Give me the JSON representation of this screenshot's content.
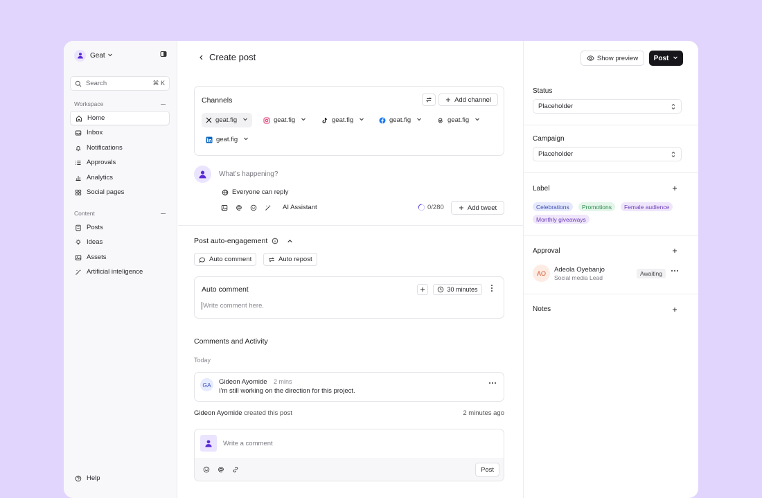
{
  "sidebar": {
    "workspace_name": "Geat",
    "search_placeholder": "Search",
    "search_shortcut": "⌘ K",
    "workspace_section": "Workspace",
    "workspace_items": [
      {
        "label": "Home",
        "icon": "home-icon"
      },
      {
        "label": "Inbox",
        "icon": "inbox-icon"
      },
      {
        "label": "Notifications",
        "icon": "bell-icon"
      },
      {
        "label": "Approvals",
        "icon": "list-icon"
      },
      {
        "label": "Analytics",
        "icon": "bar-chart-icon"
      },
      {
        "label": "Social pages",
        "icon": "grid-icon"
      }
    ],
    "content_section": "Content",
    "content_items": [
      {
        "label": "Posts",
        "icon": "document-icon"
      },
      {
        "label": "Ideas",
        "icon": "lightbulb-icon"
      },
      {
        "label": "Assets",
        "icon": "image-icon"
      },
      {
        "label": "Artificial inteligence",
        "icon": "sparkle-wand-icon"
      }
    ],
    "help": "Help"
  },
  "header": {
    "title": "Create post",
    "preview_label": "Show preview",
    "post_label": "Post"
  },
  "channels": {
    "title": "Channels",
    "add_label": "Add channel",
    "chips": [
      {
        "network": "x",
        "label": "geat.fig"
      },
      {
        "network": "instagram",
        "label": "geat.fig"
      },
      {
        "network": "tiktok",
        "label": "geat.fig"
      },
      {
        "network": "facebook",
        "label": "geat.fig"
      },
      {
        "network": "threads",
        "label": "geat.fig"
      },
      {
        "network": "linkedin",
        "label": "geat.fig"
      }
    ]
  },
  "composer": {
    "placeholder": "What’s happening?",
    "reply_setting": "Everyone can reply",
    "ai_label": "AI Assistant",
    "char_count": "0/280",
    "add_tweet": "Add tweet"
  },
  "auto_engagement": {
    "title": "Post auto-engagement",
    "auto_comment_btn": "Auto comment",
    "auto_repost_btn": "Auto repost",
    "card_title": "Auto comment",
    "delay": "30 minutes",
    "input_placeholder": "Write comment here."
  },
  "comments": {
    "title": "Comments and Activity",
    "day": "Today",
    "items": [
      {
        "initials": "GA",
        "name": "Gideon Ayomide",
        "time": "2 mins",
        "text": "I'm still working on the direction for this project."
      }
    ],
    "activity": {
      "who": "Gideon Ayomide",
      "action": " created this post",
      "time": "2 minutes ago"
    },
    "write_placeholder": "Write a comment",
    "post_label": "Post"
  },
  "right_panel": {
    "status_label": "Status",
    "status_value": "Placeholder",
    "campaign_label": "Campaign",
    "campaign_value": "Placeholder",
    "label_title": "Label",
    "tags": [
      {
        "text": "Celebrations",
        "bg": "#e5e9fb",
        "fg": "#3b4fb3"
      },
      {
        "text": "Promotions",
        "bg": "#e4f5ea",
        "fg": "#2a8a4c"
      },
      {
        "text": "Female audience",
        "bg": "#efe6fb",
        "fg": "#6e3fb8"
      },
      {
        "text": "Monthly giveaways",
        "bg": "#efe6fb",
        "fg": "#6e3fb8"
      }
    ],
    "approval_title": "Approval",
    "approver": {
      "initials": "AO",
      "name": "Adeola Oyebanjo",
      "role": "Social media Lead",
      "status": "Awaiting"
    },
    "notes_title": "Notes"
  },
  "colors": {
    "background": "#e1d5fd",
    "brand": "#5b2bd6",
    "primary_button": "#17171b"
  }
}
